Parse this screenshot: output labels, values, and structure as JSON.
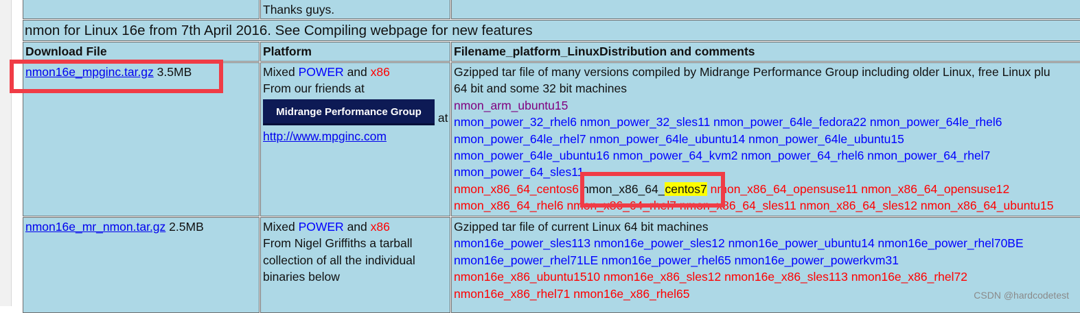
{
  "top_row": {
    "platform_tail": "Thanks guys."
  },
  "section_heading": "nmon for Linux 16e from 7th April 2016. See Compiling webpage for new features",
  "column_headers": {
    "download": "Download File",
    "platform": "Platform",
    "filename": "Filename_platform_LinuxDistribution and comments"
  },
  "row1": {
    "file_link": "nmon16e_mpginc.tar.gz",
    "file_size": "3.5MB",
    "platform_mixed": "Mixed",
    "platform_power": "POWER",
    "platform_and": "and",
    "platform_x86": "x86",
    "platform_friends": "From our friends at",
    "banner_text": "Midrange Performance Group",
    "banner_at": "at",
    "site_link": "http://www.mpginc.com",
    "desc_line1": "Gzipped tar file of many versions compiled by Midrange Performance Group including older Linux, free Linux plu",
    "desc_line2": "64 bit and some 32 bit machines",
    "arm_links": [
      "nmon_arm_ubuntu15"
    ],
    "power_links_1": [
      "nmon_power_32_rhel6",
      "nmon_power_32_sles11",
      "nmon_power_64le_fedora22",
      "nmon_power_64le_rhel6"
    ],
    "power_links_2": [
      "nmon_power_64le_rhel7",
      "nmon_power_64le_ubuntu14",
      "nmon_power_64le_ubuntu15"
    ],
    "power_links_3": [
      "nmon_power_64le_ubuntu16",
      "nmon_power_64_kvm2",
      "nmon_power_64_rhel6",
      "nmon_power_64_rhel7"
    ],
    "power_links_4": [
      "nmon_power_64_sles11"
    ],
    "x86_links_1_first": "nmon_x86_64_centos6",
    "x86_centos7_prefix": "nmon_x86_64_",
    "x86_centos7_highlight": "centos7",
    "x86_links_1_rest": [
      "nmon_x86_64_opensuse11",
      "nmon_x86_64_opensuse12"
    ],
    "x86_links_2": [
      "nmon_x86_64_rhel6",
      "nmon_x86_64_rhel7",
      "nmon_x86_64_sles11",
      "nmon_x86_64_sles12",
      "nmon_x86_64_ubuntu15"
    ]
  },
  "row2": {
    "file_link": "nmon16e_mr_nmon.tar.gz",
    "file_size": "2.5MB",
    "platform_mixed": "Mixed",
    "platform_power": "POWER",
    "platform_and": "and",
    "platform_x86": "x86",
    "platform_line2": "From Nigel Griffiths a tarball",
    "platform_line3": "collection of all the individual",
    "platform_line4": "binaries below",
    "desc_line1": "Gzipped tar file of current Linux 64 bit machines",
    "power_links_1": [
      "nmon16e_power_sles113",
      "nmon16e_power_sles12",
      "nmon16e_power_ubuntu14",
      "nmon16e_power_rhel70BE"
    ],
    "power_links_2": [
      "nmon16e_power_rhel71LE",
      "nmon16e_power_rhel65",
      "nmon16e_power_powerkvm31"
    ],
    "x86_links_1": [
      "nmon16e_x86_ubuntu1510",
      "nmon16e_x86_sles12",
      "nmon16e_x86_sles113",
      "nmon16e_x86_rhel72"
    ],
    "x86_links_2": [
      "nmon16e_x86_rhel71",
      "nmon16e_x86_rhel65"
    ]
  },
  "watermark": "CSDN @hardcodetest",
  "colors": {
    "cell_bg": "#add8e6",
    "power": "#0000ff",
    "x86": "#ff0000",
    "arm": "#800080",
    "annotation": "#f03c46",
    "highlight": "#ffff00"
  }
}
